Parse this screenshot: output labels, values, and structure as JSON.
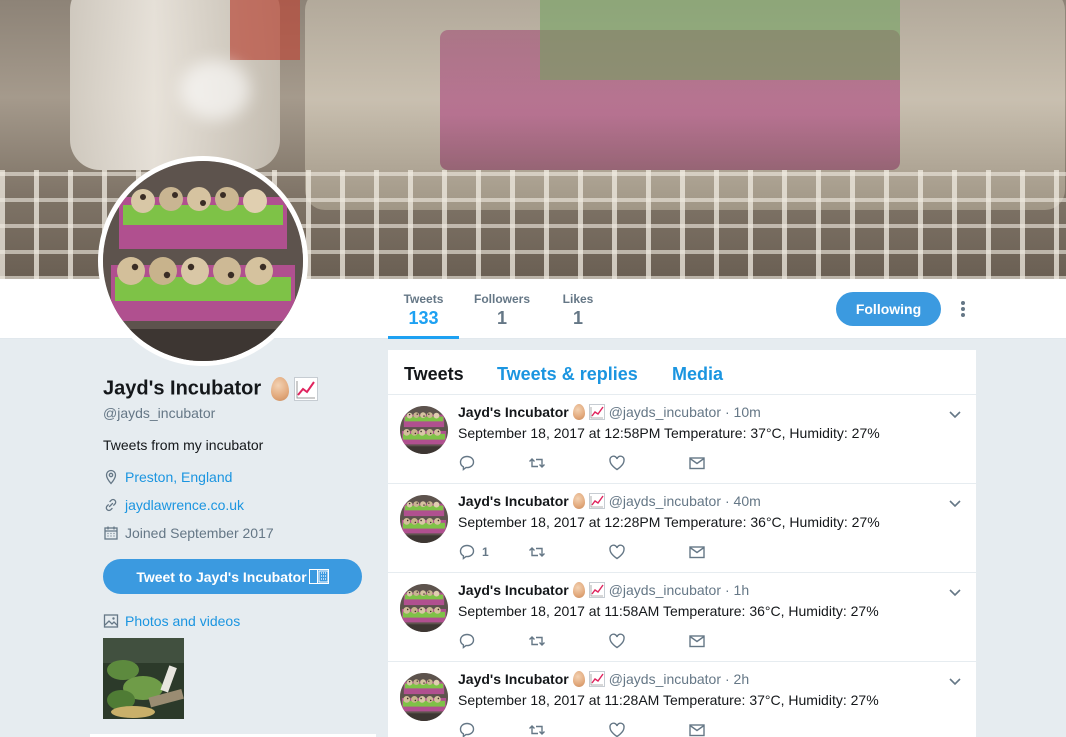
{
  "profile": {
    "name": "Jayd's Incubator",
    "screen_name": "@jayds_incubator",
    "bio": "Tweets from my incubator",
    "location": "Preston, England",
    "website": "jaydlawrence.co.uk",
    "joined": "Joined September 2017",
    "tweet_to_label": "Tweet to Jayd's Incubator",
    "photos_label": "Photos and videos"
  },
  "stats": {
    "tweets_label": "Tweets",
    "tweets_value": "133",
    "followers_label": "Followers",
    "followers_value": "1",
    "likes_label": "Likes",
    "likes_value": "1"
  },
  "actions": {
    "following_label": "Following"
  },
  "tabs": {
    "tweets": "Tweets",
    "replies": "Tweets & replies",
    "media": "Media"
  },
  "tweets": [
    {
      "name": "Jayd's Incubator",
      "handle": "@jayds_incubator",
      "time": "· 10m",
      "text": "September 18, 2017 at 12:58PM Temperature: 37°C, Humidity: 27%",
      "reply_count": ""
    },
    {
      "name": "Jayd's Incubator",
      "handle": "@jayds_incubator",
      "time": "· 40m",
      "text": "September 18, 2017 at 12:28PM Temperature: 36°C, Humidity: 27%",
      "reply_count": "1"
    },
    {
      "name": "Jayd's Incubator",
      "handle": "@jayds_incubator",
      "time": "· 1h",
      "text": "September 18, 2017 at 11:58AM Temperature: 36°C, Humidity: 27%",
      "reply_count": ""
    },
    {
      "name": "Jayd's Incubator",
      "handle": "@jayds_incubator",
      "time": "· 2h",
      "text": "September 18, 2017 at 11:28AM Temperature: 37°C, Humidity: 27%",
      "reply_count": ""
    }
  ],
  "colors": {
    "accent": "#1da1f2",
    "button": "#3b9ae0",
    "link": "#1b95e0",
    "muted": "#657786"
  },
  "icons": [
    "egg-emoji",
    "chart-increasing-emoji",
    "location-icon",
    "link-icon",
    "calendar-icon",
    "photo-icon",
    "reply-icon",
    "retweet-icon",
    "like-icon",
    "dm-icon",
    "caret-down-icon",
    "more-icon"
  ]
}
